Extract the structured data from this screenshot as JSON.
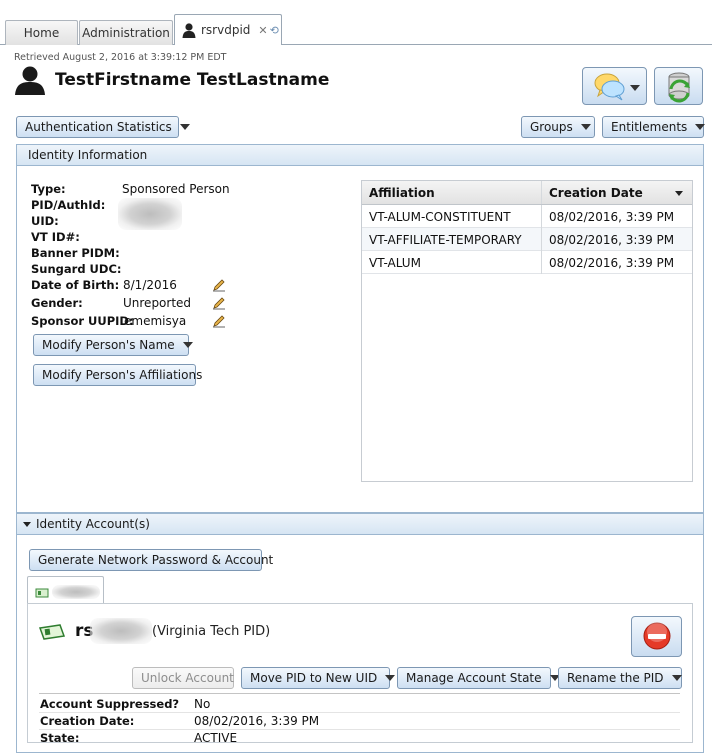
{
  "tabs": [
    {
      "label": "Home"
    },
    {
      "label": "Administration"
    },
    {
      "label": "rsrvdpid"
    }
  ],
  "header": {
    "retrieved": "Retrieved August 2, 2016 at 3:39:12 PM EDT",
    "person_name": "TestFirstname TestLastname"
  },
  "toolbar": {
    "auth_stats": "Authentication Statistics",
    "groups": "Groups",
    "entitlements": "Entitlements"
  },
  "identity": {
    "title": "Identity Information",
    "fields": [
      {
        "label": "Type:",
        "value": "Sponsored Person"
      },
      {
        "label": "PID/AuthId:",
        "value": ""
      },
      {
        "label": "UID:",
        "value": ""
      },
      {
        "label": "VT ID#:",
        "value": ""
      },
      {
        "label": "Banner PIDM:",
        "value": ""
      },
      {
        "label": "Sungard UDC:",
        "value": ""
      },
      {
        "label": "Date of Birth:",
        "value": "8/1/2016"
      },
      {
        "label": "Gender:",
        "value": "Unreported"
      },
      {
        "label": "Sponsor UUPID:",
        "value": "ememisya"
      }
    ],
    "modify_name": "Modify Person's Name",
    "modify_affiliations": "Modify Person's Affiliations"
  },
  "affiliations": {
    "columns": [
      "Affiliation",
      "Creation Date"
    ],
    "rows": [
      {
        "affiliation": "VT-ALUM-CONSTITUENT",
        "created": "08/02/2016, 3:39 PM"
      },
      {
        "affiliation": "VT-AFFILIATE-TEMPORARY",
        "created": "08/02/2016, 3:39 PM"
      },
      {
        "affiliation": "VT-ALUM",
        "created": "08/02/2016, 3:39 PM"
      }
    ]
  },
  "accounts": {
    "title": "Identity Account(s)",
    "generate_button": "Generate Network Password & Account",
    "account_prefix": "rs",
    "account_type": "(Virginia Tech PID)",
    "actions": {
      "unlock": "Unlock Account",
      "move": "Move PID to New UID",
      "manage": "Manage Account State",
      "rename": "Rename the PID"
    },
    "details": [
      {
        "label": "Account Suppressed?",
        "value": "No"
      },
      {
        "label": "Creation Date:",
        "value": "08/02/2016, 3:39 PM"
      },
      {
        "label": "State:",
        "value": "ACTIVE"
      }
    ]
  }
}
